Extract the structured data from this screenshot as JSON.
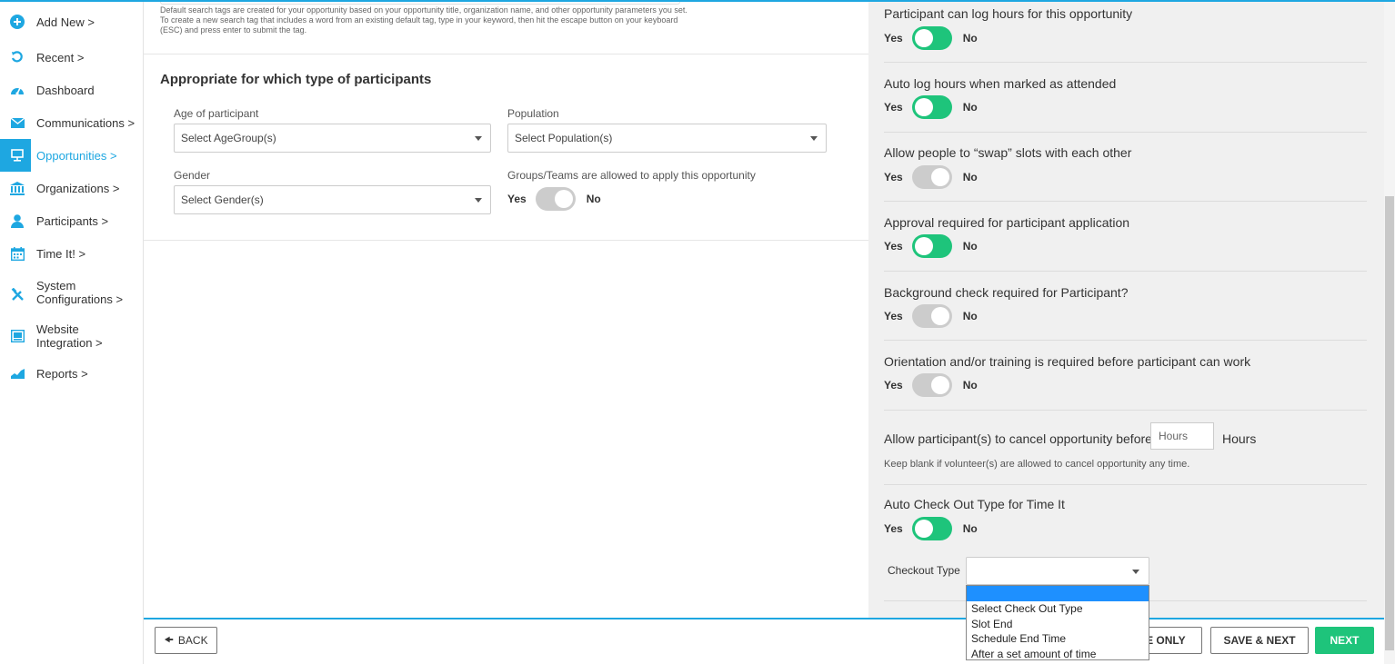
{
  "sidebar": {
    "items": [
      {
        "label": "Add New",
        "icon": "plus-circle-icon"
      },
      {
        "label": "Recent",
        "icon": "undo-icon"
      },
      {
        "label": "Dashboard",
        "icon": "gauge-icon"
      },
      {
        "label": "Communications",
        "icon": "envelope-icon"
      },
      {
        "label": "Opportunities",
        "icon": "presentation-icon"
      },
      {
        "label": "Organizations",
        "icon": "bank-icon"
      },
      {
        "label": "Participants",
        "icon": "user-icon"
      },
      {
        "label": "Time It!",
        "icon": "calendar-icon"
      },
      {
        "label": "System",
        "label2": "Configurations",
        "icon": "tools-icon"
      },
      {
        "label": "Website",
        "label2": "Integration",
        "icon": "monitor-icon"
      },
      {
        "label": "Reports",
        "icon": "chart-icon"
      }
    ]
  },
  "left": {
    "tag_note": "Default search tags are created for your opportunity based on your opportunity title, organization name, and other opportunity parameters you set. To create a new search tag that includes a word from an existing default tag, type in your keyword, then hit the escape button on your keyboard (ESC) and press enter to submit the tag.",
    "section_title": "Appropriate for which type of participants",
    "age_label": "Age of participant",
    "age_placeholder": "Select AgeGroup(s)",
    "population_label": "Population",
    "population_placeholder": "Select Population(s)",
    "gender_label": "Gender",
    "gender_placeholder": "Select Gender(s)",
    "groups_label": "Groups/Teams are allowed to apply this opportunity",
    "groups_toggle": false
  },
  "yes_label": "Yes",
  "no_label": "No",
  "right": {
    "questions": [
      {
        "label": "Participant can log hours for this opportunity",
        "on": true
      },
      {
        "label": "Auto log hours when marked as attended",
        "on": true
      },
      {
        "label": "Allow people to “swap” slots with each other",
        "on": false
      },
      {
        "label": "Approval required for participant application",
        "on": true
      },
      {
        "label": "Background check required for Participant?",
        "on": false
      },
      {
        "label": "Orientation and/or training is required before participant can work",
        "on": false
      }
    ],
    "cancel_label": "Allow participant(s) to cancel opportunity before",
    "hours_placeholder": "Hours",
    "hours_suffix": "Hours",
    "cancel_hint": "Keep blank if volunteer(s) are allowed to cancel opportunity any time.",
    "auto_checkout_label": "Auto Check Out Type for Time It",
    "auto_checkout_on": true,
    "checkout_type_label": "Checkout Type",
    "checkout_options": [
      "",
      "Select Check Out Type",
      "Slot End",
      "Schedule End Time",
      "After a set amount of time"
    ]
  },
  "footer": {
    "back": "BACK",
    "save_only": "SAVE ONLY",
    "save_next": "SAVE & NEXT",
    "next": "NEXT"
  },
  "colors": {
    "accent": "#1ea7e1",
    "toggle_on": "#1ec47b",
    "toggle_off": "#cccccc"
  }
}
